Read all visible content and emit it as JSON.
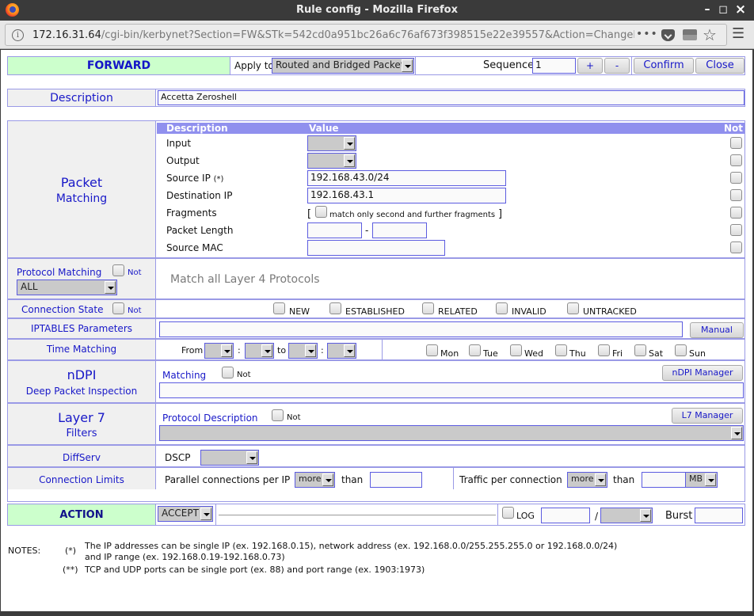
{
  "window": {
    "title": "Rule config - Mozilla Firefox",
    "minimize": "–",
    "maximize": "◻",
    "close": "×"
  },
  "browser": {
    "url_host": "172.16.31.64",
    "url_path": "/cgi-bin/kerbynet?Section=FW&STk=542cd0a951bc26a6c76af673f398515e22e39557&Action=ChangeRule&Chain=FORWAR",
    "more": "•••",
    "icons": {
      "info": "i",
      "star": "☆",
      "menu": "☰"
    }
  },
  "header": {
    "chain": "FORWARD",
    "apply_to_label": "Apply to",
    "apply_to_value": "Routed and Bridged Packets",
    "sequence_label": "Sequence",
    "sequence_value": "1",
    "plus": "+",
    "minus": "-",
    "confirm": "Confirm",
    "close": "Close"
  },
  "description": {
    "label": "Description",
    "value": "Accetta Zeroshell"
  },
  "packet_matching": {
    "title": "Packet",
    "subtitle": "Matching",
    "col_description": "Description",
    "col_value": "Value",
    "col_not": "Not",
    "input_label": "Input",
    "input_value": "",
    "output_label": "Output",
    "output_value": "",
    "source_ip_label": "Source IP",
    "source_ip_note": "(*)",
    "source_ip_value": "192.168.43.0/24",
    "destination_ip_label": "Destination IP",
    "destination_ip_value": "192.168.43.1",
    "fragments_label": "Fragments",
    "fragments_open": "[",
    "fragments_text": "match only second and further fragments",
    "fragments_close": "]",
    "packet_length_label": "Packet Length",
    "packet_length_from": "",
    "packet_length_sep": "-",
    "packet_length_to": "",
    "source_mac_label": "Source MAC",
    "source_mac_value": ""
  },
  "protocol_matching": {
    "label": "Protocol Matching",
    "not": "Not",
    "value": "ALL",
    "info": "Match all Layer 4 Protocols"
  },
  "connection_state": {
    "label": "Connection State",
    "not": "Not",
    "states": [
      "NEW",
      "ESTABLISHED",
      "RELATED",
      "INVALID",
      "UNTRACKED"
    ]
  },
  "iptables": {
    "label": "IPTABLES Parameters",
    "value": "",
    "manual": "Manual"
  },
  "time_matching": {
    "label": "Time Matching",
    "from": "From",
    "to": "to",
    "colon": ":",
    "days": [
      "Mon",
      "Tue",
      "Wed",
      "Thu",
      "Fri",
      "Sat",
      "Sun"
    ]
  },
  "ndpi": {
    "title": "nDPI",
    "subtitle": "Deep Packet Inspection",
    "matching": "Matching",
    "not": "Not",
    "manager": "nDPI Manager",
    "value": ""
  },
  "layer7": {
    "title": "Layer 7",
    "subtitle": "Filters",
    "protocol_description": "Protocol Description",
    "not": "Not",
    "manager": "L7 Manager",
    "value": ""
  },
  "diffserv": {
    "label": "DiffServ",
    "dscp": "DSCP",
    "value": ""
  },
  "connection_limits": {
    "label": "Connection Limits",
    "parallel_label": "Parallel connections per IP",
    "parallel_cmp": "more",
    "than": "than",
    "parallel_value": "",
    "traffic_label": "Traffic per connection",
    "traffic_cmp": "more",
    "traffic_value": "",
    "traffic_unit": "MB"
  },
  "action": {
    "label": "ACTION",
    "value": "ACCEPT",
    "log": "LOG",
    "log_rate": "",
    "slash": "/",
    "log_unit": "",
    "burst": "Burst",
    "burst_value": ""
  },
  "notes": {
    "label": "NOTES:",
    "items": [
      {
        "mark": "(*)",
        "line1": "The IP addresses can be single IP (ex. 192.168.0.15), network address (ex. 192.168.0.0/255.255.255.0 or 192.168.0.0/24)",
        "line2": "and IP range (ex. 192.168.0.19-192.168.0.73)"
      },
      {
        "mark": "(**)",
        "line1": "TCP and UDP ports can be single port (ex. 88) and port range (ex. 1903:1973)"
      }
    ]
  }
}
